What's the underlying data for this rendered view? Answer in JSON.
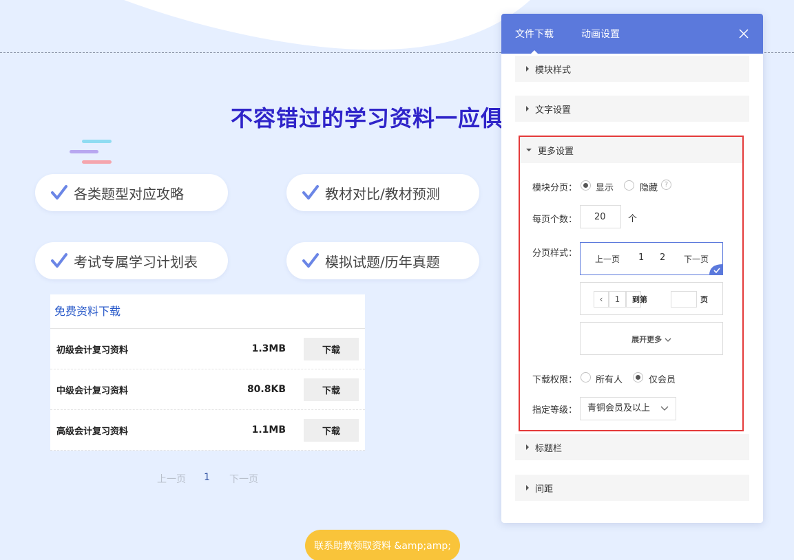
{
  "page": {
    "headline": "不容错过的学习资料一应俱",
    "features": [
      "各类题型对应攻略",
      "教材对比/教材预测",
      "考试专属学习计划表",
      "模拟试题/历年真题"
    ],
    "downloads": {
      "title": "免费资料下载",
      "rows": [
        {
          "name": "初级会计复习资料",
          "size": "1.3MB",
          "action": "下载"
        },
        {
          "name": "中级会计复习资料",
          "size": "80.8KB",
          "action": "下载"
        },
        {
          "name": "高级会计复习资料",
          "size": "1.1MB",
          "action": "下载"
        }
      ]
    },
    "pager": {
      "prev": "上一页",
      "current": "1",
      "next": "下一页"
    },
    "contact_button": "联系助教领取资料 &amp;amp;"
  },
  "panel": {
    "tabs": [
      "文件下载",
      "动画设置"
    ],
    "sections": {
      "module_style": "模块样式",
      "text_settings": "文字设置",
      "more_settings": "更多设置",
      "title_bar": "标题栏",
      "spacing": "间距"
    },
    "more": {
      "pagination_label": "模块分页：",
      "pagination_options": [
        "显示",
        "隐藏"
      ],
      "pagination_selected": "显示",
      "help_glyph": "?",
      "per_page_label": "每页个数：",
      "per_page_value": "20",
      "per_page_unit": "个",
      "page_style_label": "分页样式：",
      "style1": {
        "prev": "上一页",
        "n1": "1",
        "n2": "2",
        "next": "下一页"
      },
      "style2": {
        "left_arrow": "‹",
        "page": "1",
        "right_arrow": "›",
        "goto": "到第",
        "page_unit": "页"
      },
      "expand_more": "展开更多",
      "permission_label": "下载权限：",
      "permission_options": [
        "所有人",
        "仅会员"
      ],
      "permission_selected": "仅会员",
      "level_label": "指定等级：",
      "level_value": "青铜会员及以上"
    }
  },
  "colors": {
    "background": "#e6efff",
    "headline": "#2f24c9",
    "panel_header": "#5b79dc",
    "highlight_border": "#e43a3a",
    "contact_button": "#f9c43a",
    "check": "#6b86e6"
  }
}
